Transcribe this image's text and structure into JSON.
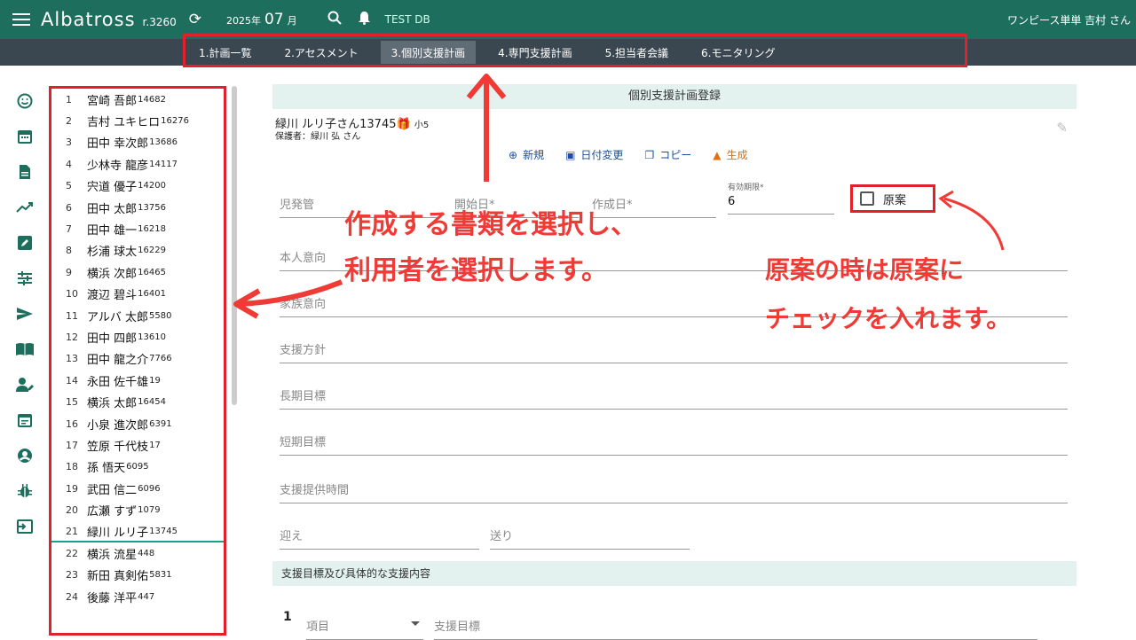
{
  "app": {
    "logo": "Albatross",
    "version": "r.3260",
    "date_year": "2025年",
    "date_month": "07",
    "date_suffix": "月",
    "db_label": "TEST DB",
    "user_label": "ワンピース単単 吉村 さん"
  },
  "tabs": [
    "1.計画一覧",
    "2.アセスメント",
    "3.個別支援計画",
    "4.専門支援計画",
    "5.担当者会議",
    "6.モニタリング"
  ],
  "active_tab": "3.個別支援計画",
  "sidebar_icons": [
    "smiley-icon",
    "calendar-icon",
    "document-icon",
    "trend-icon",
    "edit-icon",
    "tune-icon",
    "send-icon",
    "book-icon",
    "person-edit-icon",
    "event-icon",
    "account-icon",
    "bug-icon",
    "logout-icon"
  ],
  "persons": [
    {
      "no": "1",
      "name": "宮崎 吾郎",
      "id": "14682"
    },
    {
      "no": "2",
      "name": "吉村 ユキヒロ",
      "id": "16276"
    },
    {
      "no": "3",
      "name": "田中 幸次郎",
      "id": "13686"
    },
    {
      "no": "4",
      "name": "少林寺 龍彦",
      "id": "14117"
    },
    {
      "no": "5",
      "name": "宍道 優子",
      "id": "14200"
    },
    {
      "no": "6",
      "name": "田中 太郎",
      "id": "13756"
    },
    {
      "no": "7",
      "name": "田中 雄一",
      "id": "16218"
    },
    {
      "no": "8",
      "name": "杉浦 球太",
      "id": "16229"
    },
    {
      "no": "9",
      "name": "横浜 次郎",
      "id": "16465"
    },
    {
      "no": "10",
      "name": "渡辺 碧斗",
      "id": "16401"
    },
    {
      "no": "11",
      "name": "アルバ 太郎",
      "id": "5580"
    },
    {
      "no": "12",
      "name": "田中 四郎",
      "id": "13610"
    },
    {
      "no": "13",
      "name": "田中 龍之介",
      "id": "7766"
    },
    {
      "no": "14",
      "name": "永田 佐千雄",
      "id": "19"
    },
    {
      "no": "15",
      "name": "横浜 太郎",
      "id": "16454"
    },
    {
      "no": "16",
      "name": "小泉 進次郎",
      "id": "6391"
    },
    {
      "no": "17",
      "name": "笠原 千代枝",
      "id": "17"
    },
    {
      "no": "18",
      "name": "孫 悟天",
      "id": "6095"
    },
    {
      "no": "19",
      "name": "武田 信二",
      "id": "6096"
    },
    {
      "no": "20",
      "name": "広瀬 すず",
      "id": "1079"
    },
    {
      "no": "21",
      "name": "緑川 ルリ子",
      "id": "13745"
    },
    {
      "no": "22",
      "name": "横浜 流星",
      "id": "448"
    },
    {
      "no": "23",
      "name": "新田 真剣佑",
      "id": "5831"
    },
    {
      "no": "24",
      "name": "後藤 洋平",
      "id": "447"
    }
  ],
  "selected_person_index": 20,
  "form": {
    "header": "個別支援計画登録",
    "client": "緑川 ルリ子さん13745",
    "grade": "小5",
    "guardian": "保護者：緑川 弘 さん",
    "actions": {
      "new": "新規",
      "date_change": "日付変更",
      "copy": "コピー",
      "generate": "生成"
    },
    "fields": {
      "jihatsukan": "児発管",
      "start_date": "開始日*",
      "created_date": "作成日*",
      "validity_caption": "有効期限*",
      "validity_value": "6",
      "draft": "原案",
      "self_intent": "本人意向",
      "family_intent": "家族意向",
      "policy": "支援方針",
      "long_goal": "長期目標",
      "short_goal": "短期目標",
      "support_time": "支援提供時間",
      "pickup": "迎え",
      "dropoff": "送り"
    },
    "section": "支援目標及び具体的な支援内容",
    "row1_no": "1",
    "item_select": "項目",
    "goal_placeholder": "支援目標"
  },
  "annotations": {
    "left_line1": "作成する書類を選択し、",
    "left_line2": "利用者を選択します。",
    "right_line1": "原案の時は原案に",
    "right_line2": "チェックを入れます。"
  },
  "colors": {
    "brand": "#1e6e5e",
    "accent_red": "#e0202a",
    "annot_red": "#ef3a36"
  }
}
